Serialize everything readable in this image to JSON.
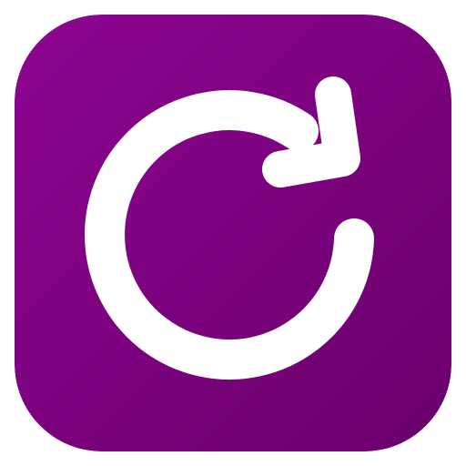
{
  "icon": {
    "name": "refresh-icon",
    "colors": {
      "gradient_start": "#8d0590",
      "gradient_end": "#6a006c",
      "glyph": "#ffffff"
    }
  }
}
